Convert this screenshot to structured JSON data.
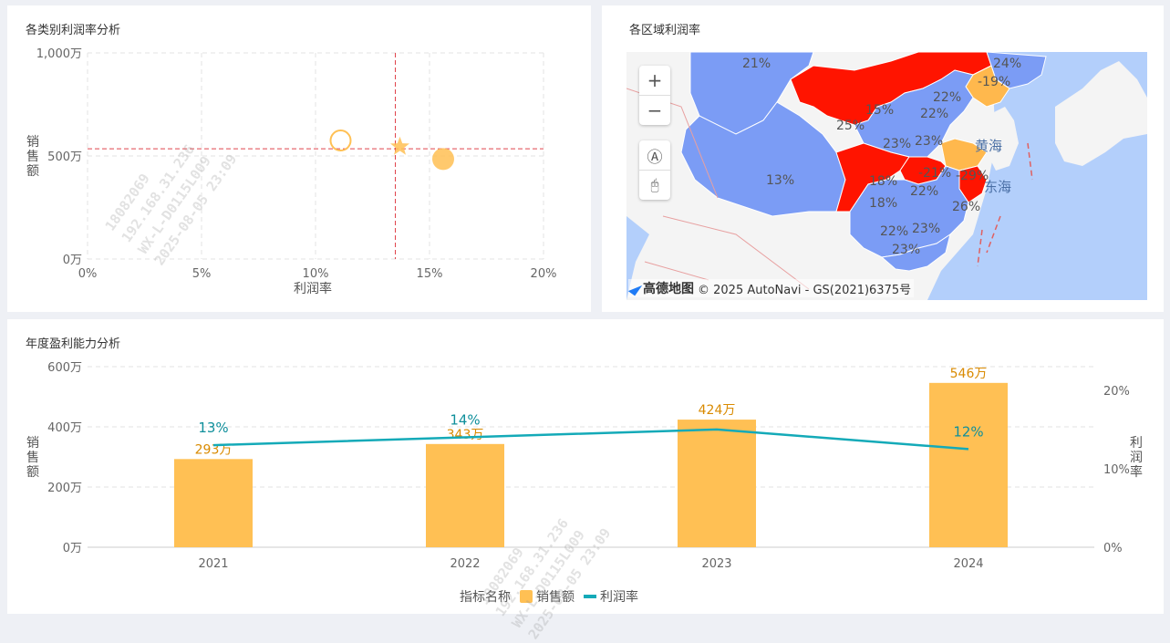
{
  "scatter_panel": {
    "title": "各类别利润率分析",
    "ylabel": "销售额",
    "xlabel": "利润率",
    "x_ticks": [
      "0%",
      "5%",
      "10%",
      "15%",
      "20%"
    ],
    "y_ticks": [
      "1,000万",
      "500万",
      "0万"
    ],
    "ref_x": 13.5,
    "ref_y": 535,
    "chart_data": {
      "type": "scatter",
      "xlabel": "利润率",
      "ylabel": "销售额",
      "xlim": [
        0,
        20
      ],
      "ylim": [
        0,
        1000
      ],
      "points": [
        {
          "x": 11.1,
          "y": 575,
          "shape": "circle-outline"
        },
        {
          "x": 13.7,
          "y": 545,
          "shape": "star"
        },
        {
          "x": 15.6,
          "y": 485,
          "shape": "circle"
        }
      ]
    }
  },
  "map_panel": {
    "title": "各区域利润率",
    "attribution_brand": "高德地图",
    "attribution_text": "© 2025 AutoNavi - GS(2021)6375号",
    "sea_labels": [
      "黄海",
      "东海"
    ],
    "controls": {
      "zoom_in": "+",
      "zoom_out": "−",
      "compass": "Ⓐ",
      "mouse": "🖰"
    },
    "region_labels": [
      "21%",
      "24%",
      "-19%",
      "22%",
      "15%",
      "22%",
      "25%",
      "23%",
      "23%",
      "13%",
      "18%",
      "-21%",
      "-29%",
      "18%",
      "22%",
      "26%",
      "22%",
      "23%",
      "23%"
    ]
  },
  "bar_panel": {
    "title": "年度盈利能力分析",
    "ylabel": "销售额",
    "y2label": "利润率",
    "y_ticks": [
      "600万",
      "400万",
      "200万",
      "0万"
    ],
    "y2_ticks": [
      "20%",
      "10%",
      "0%"
    ],
    "legend_title": "指标名称",
    "legend": [
      "销售额",
      "利润率"
    ],
    "chart_data": {
      "type": "bar",
      "categories": [
        "2021",
        "2022",
        "2023",
        "2024"
      ],
      "series": [
        {
          "name": "销售额",
          "values": [
            293,
            343,
            424,
            546
          ],
          "labels": [
            "293万",
            "343万",
            "424万",
            "546万"
          ],
          "color": "#ffc054"
        },
        {
          "name": "利润率",
          "values": [
            13,
            14,
            15,
            12.5
          ],
          "labels": [
            "13%",
            "14%",
            "",
            "12%"
          ],
          "color": "#14aab8"
        }
      ],
      "ylim": [
        0,
        600
      ],
      "y2lim": [
        0,
        23
      ]
    }
  },
  "watermark": {
    "lines": [
      "18082069",
      "192.168.31.236",
      "WX-L-D0115L009",
      "2025-08-05 23:09"
    ]
  },
  "colors": {
    "accent_red": "#ff1400",
    "accent_orange": "#ffb84d",
    "region_blue": "#7b9cf5",
    "sea": "#b3cffb"
  }
}
